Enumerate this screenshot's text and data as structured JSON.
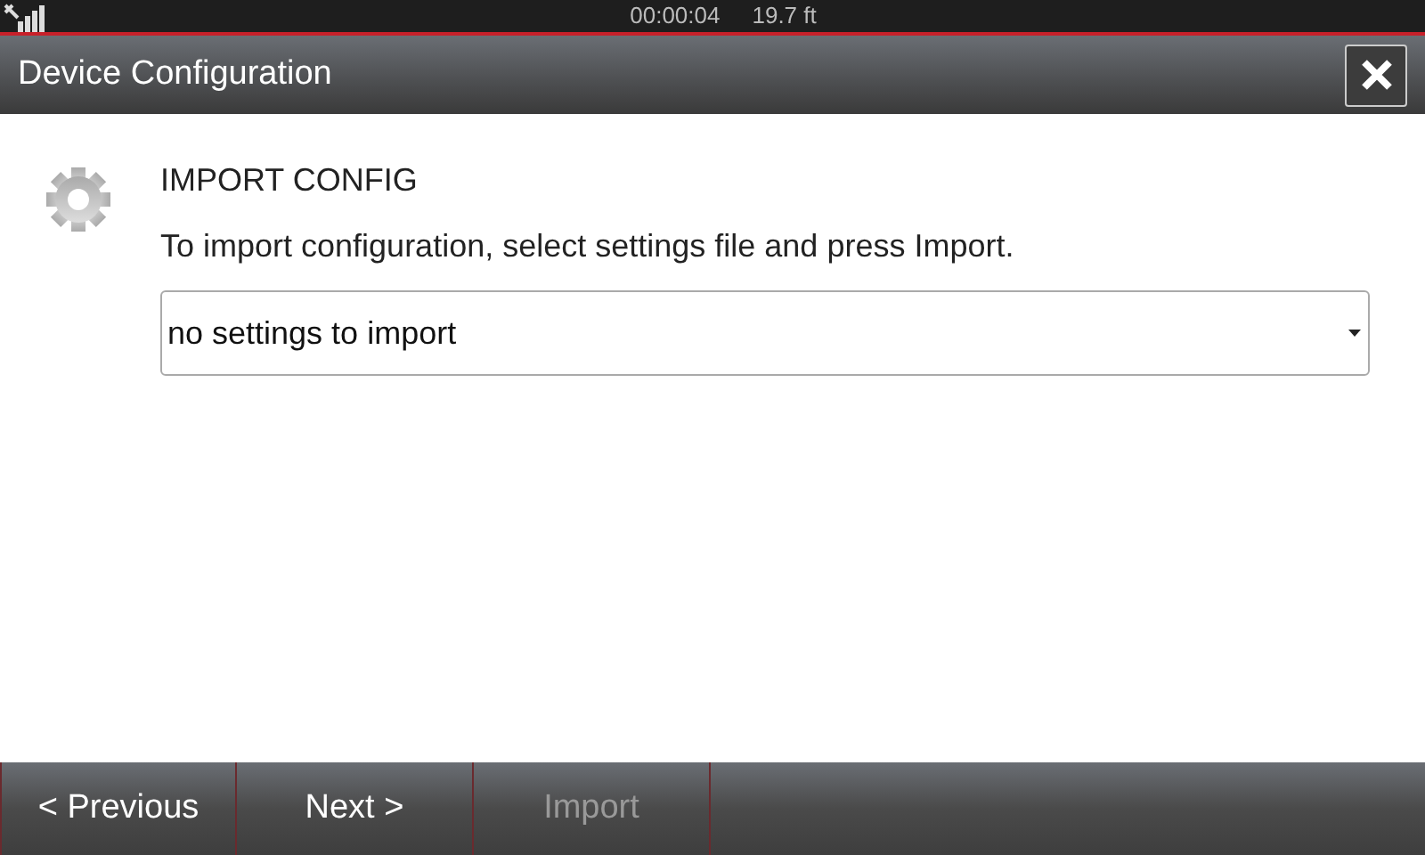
{
  "status_bar": {
    "time": "00:00:04",
    "depth": "19.7 ft"
  },
  "window": {
    "title": "Device Configuration"
  },
  "section": {
    "title": "IMPORT CONFIG",
    "description": "To import configuration, select settings file and press Import.",
    "dropdown": {
      "value": "no settings to import"
    }
  },
  "buttons": [
    {
      "label": "< Previous",
      "disabled": false
    },
    {
      "label": "Next >",
      "disabled": false
    },
    {
      "label": "Import",
      "disabled": true
    }
  ]
}
